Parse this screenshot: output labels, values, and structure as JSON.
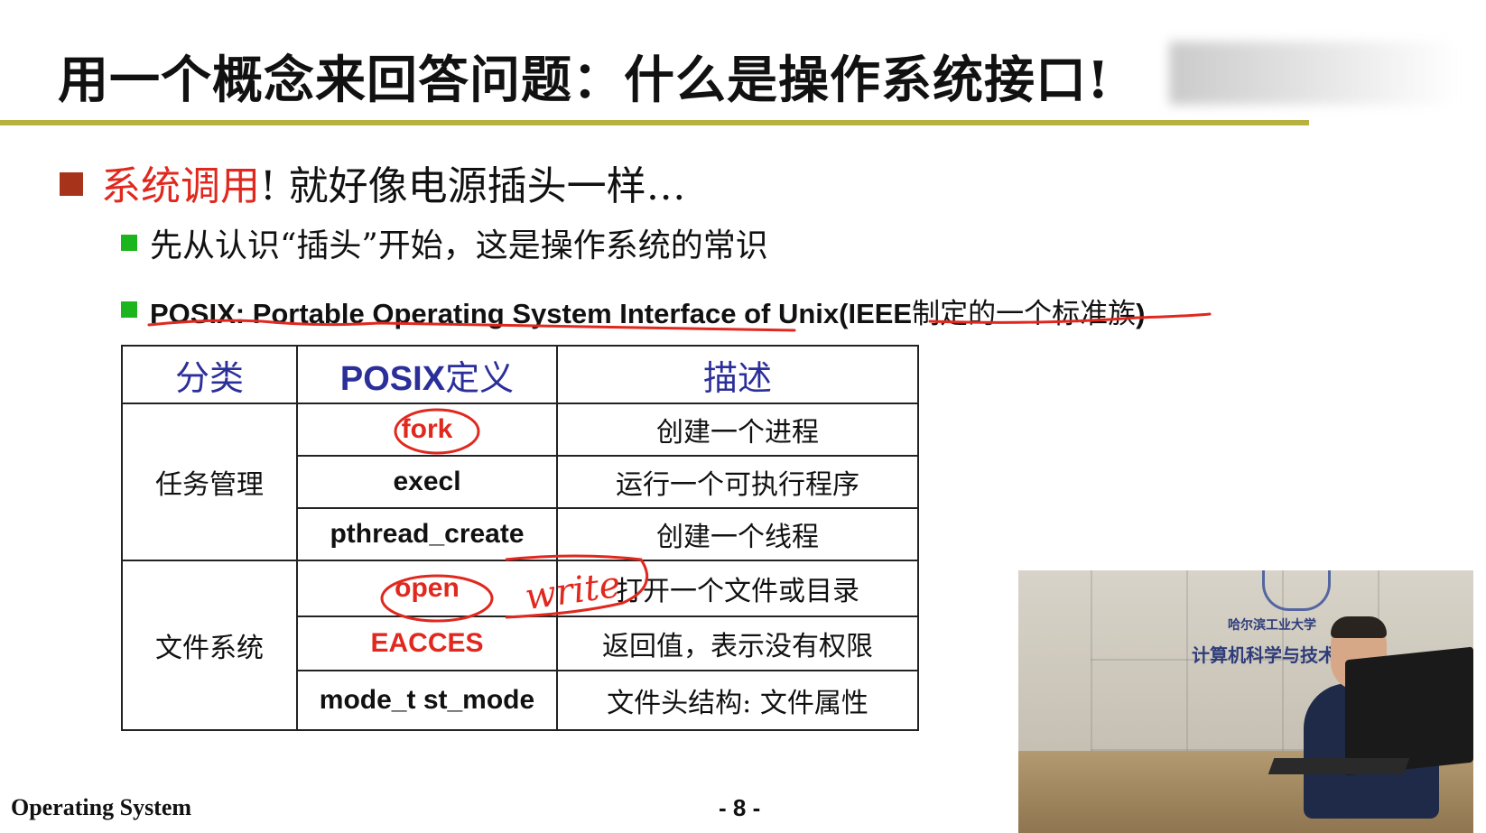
{
  "slide": {
    "title": "用一个概念来回答问题：什么是操作系统接口",
    "title_mark": "!",
    "bullet1": {
      "highlight": "系统调用",
      "rest": "! 就好像电源插头一样…"
    },
    "bullet2": "先从认识“插头”开始，这是操作系统的常识",
    "bullet3": {
      "latin": "POSIX: Portable Operating System Interface of Unix(IEEE",
      "cn": "制定的一个标准族",
      "close": ")"
    },
    "table": {
      "headers": {
        "category": "分类",
        "posix_latin": "POSIX",
        "posix_cn": "定义",
        "description": "描述"
      },
      "groups": [
        {
          "category": "任务管理",
          "rows": [
            {
              "def": "fork",
              "desc": "创建一个进程"
            },
            {
              "def": "execl",
              "desc": "运行一个可执行程序"
            },
            {
              "def": "pthread_create",
              "desc": "创建一个线程"
            }
          ]
        },
        {
          "category": "文件系统",
          "rows": [
            {
              "def": "open",
              "desc": "打开一个文件或目录"
            },
            {
              "def": "EACCES",
              "desc": "返回值，表示没有权限"
            },
            {
              "def": "mode_t st_mode",
              "desc": "文件头结构: 文件属性"
            }
          ]
        }
      ]
    },
    "annotation_handwritten": "write",
    "footer_left": "Operating System",
    "footer_page": "- 8 -"
  },
  "webcam": {
    "sign_line1": "哈尔滨工业大学",
    "sign_line2": "计算机科学与技术学院"
  },
  "colors": {
    "title_rule": "#b9b13f",
    "bullet_level1": "#a6331a",
    "bullet_level2": "#1db51d",
    "highlight_red": "#e0281e",
    "header_blue": "#2b2f9a",
    "ink_red": "#e0281e"
  }
}
